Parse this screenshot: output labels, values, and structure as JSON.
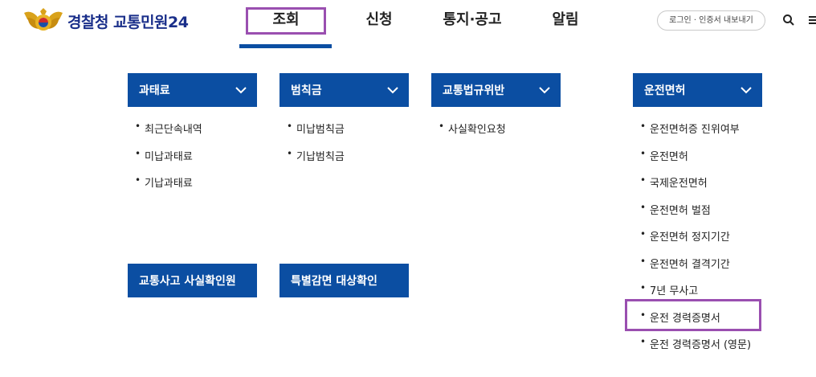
{
  "header": {
    "logo_text": "경찰청 교통민원24",
    "nav": [
      {
        "label": "조회"
      },
      {
        "label": "신청"
      },
      {
        "label": "통지·공고"
      },
      {
        "label": "알림"
      }
    ],
    "login_label": "로그인 · 인증서 내보내기"
  },
  "categories": [
    {
      "label": "과태료",
      "items": [
        "최근단속내역",
        "미납과태료",
        "기납과태료"
      ]
    },
    {
      "label": "범칙금",
      "items": [
        "미납범칙금",
        "기납범칙금"
      ]
    },
    {
      "label": "교통법규위반",
      "items": [
        "사실확인요청"
      ]
    },
    {
      "label": "운전면허",
      "items": [
        "운전면허증 진위여부",
        "운전면허",
        "국제운전면허",
        "운전면허 벌점",
        "운전면허 정지기간",
        "운전면허 결격기간",
        "7년 무사고",
        "운전 경력증명서",
        "운전 경력증명서 (영문)"
      ]
    }
  ],
  "single_buttons": [
    {
      "label": "교통사고 사실확인원"
    },
    {
      "label": "특별감면 대상확인"
    }
  ],
  "bullet": "•",
  "icons": [
    "police-emblem-icon",
    "search-icon",
    "menu-icon",
    "chevron-down-icon"
  ],
  "colors": {
    "brand_blue": "#0b4ea2",
    "logo_text": "#1a2f8a",
    "highlight": "#9a4fb0"
  }
}
